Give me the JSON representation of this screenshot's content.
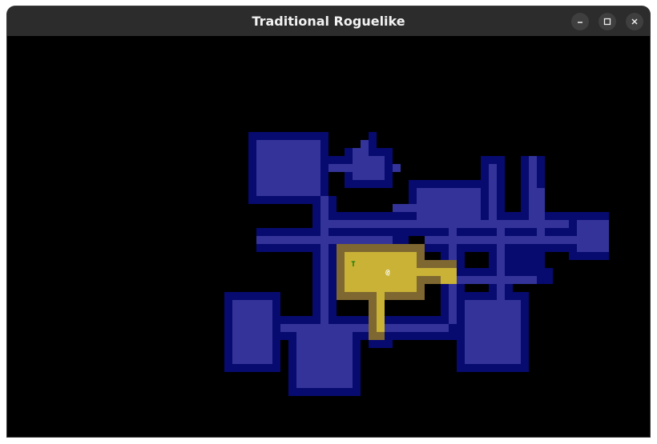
{
  "window": {
    "title": "Traditional Roguelike",
    "controls": [
      "minimize",
      "maximize",
      "close"
    ]
  },
  "colors": {
    "background": "#000000",
    "dark_wall": "#070a6e",
    "dark_floor": "#33339a",
    "lit_wall": "#7e6730",
    "lit_floor": "#c9b235",
    "player": "#ffffff",
    "troll": "#0a7a0a"
  },
  "entities": [
    {
      "name": "player",
      "char": "@",
      "color": "#ffffff"
    },
    {
      "name": "troll",
      "char": "T",
      "color": "#0a7a0a"
    }
  ]
}
